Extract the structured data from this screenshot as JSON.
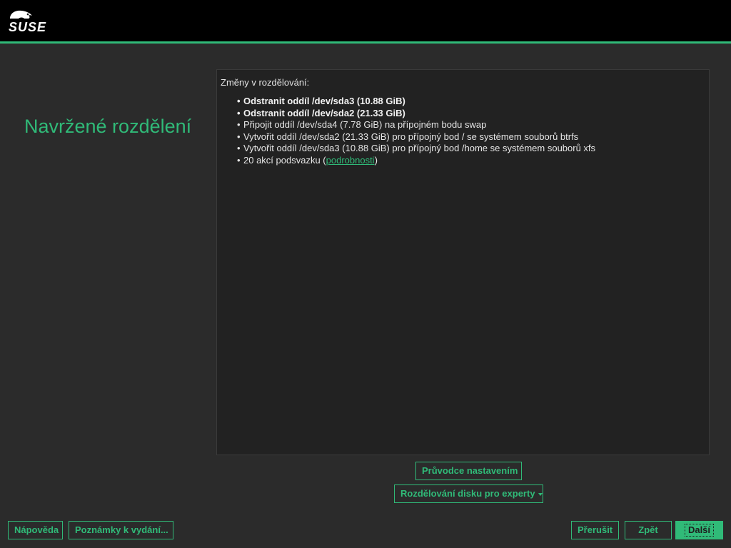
{
  "header": {
    "logo_text": "SUSE",
    "logo_icon": "suse-chameleon-icon",
    "accent_color": "#30ba78"
  },
  "page_title": "Navržené rozdělení",
  "panel": {
    "heading": "Změny v rozdělování:",
    "changes": [
      {
        "text": "Odstranit oddíl /dev/sda3 (10.88 GiB)",
        "bold": true
      },
      {
        "text": "Odstranit oddíl /dev/sda2 (21.33 GiB)",
        "bold": true
      },
      {
        "text": "Připojit oddíl /dev/sda4 (7.78 GiB) na přípojném bodu swap",
        "bold": false
      },
      {
        "text": "Vytvořit oddíl /dev/sda2 (21.33 GiB) pro přípojný bod / se systémem souborů btrfs",
        "bold": false
      },
      {
        "text": "Vytvořit oddíl /dev/sda3 (10.88 GiB) pro přípojný bod /home se systémem souborů xfs",
        "bold": false
      }
    ],
    "subvolume_prefix": "20 akcí podsvazku (",
    "subvolume_link": "podrobnosti",
    "subvolume_suffix": ")"
  },
  "actions": {
    "guided_setup": "Průvodce nastavením",
    "expert_partitioner": "Rozdělování disku pro experty"
  },
  "footer": {
    "help": "Nápověda",
    "release_notes": "Poznámky k vydání...",
    "abort": "Přerušit",
    "back": "Zpět",
    "next": "Další"
  }
}
